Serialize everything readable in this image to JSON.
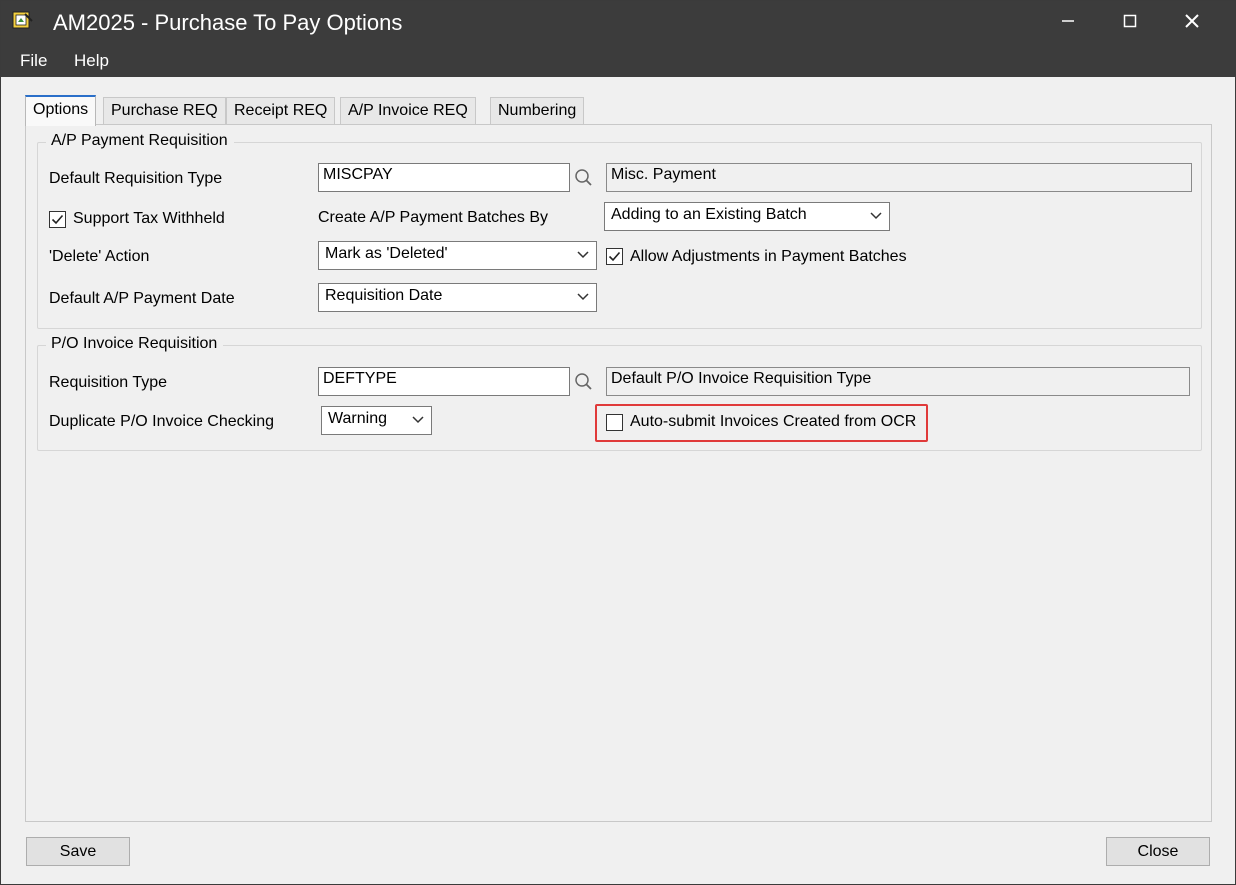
{
  "window": {
    "title": "AM2025 - Purchase To Pay Options",
    "icon": "app-icon",
    "controls": {
      "minimize": "minimize-icon",
      "maximize": "maximize-icon",
      "close": "close-icon"
    }
  },
  "menu": {
    "file": "File",
    "help": "Help"
  },
  "tabs": [
    {
      "label": "Options",
      "active": true
    },
    {
      "label": "Purchase REQ",
      "active": false
    },
    {
      "label": "Receipt REQ",
      "active": false
    },
    {
      "label": "A/P Invoice REQ",
      "active": false
    },
    {
      "label": "Numbering",
      "active": false
    }
  ],
  "ap_payment": {
    "legend": "A/P Payment Requisition",
    "default_req_type_label": "Default Requisition Type",
    "default_req_type_value": "MISCPAY",
    "default_req_type_desc": "Misc. Payment",
    "support_tax_withheld_label": "Support Tax Withheld",
    "support_tax_withheld_checked": true,
    "create_batches_label": "Create A/P Payment Batches By",
    "create_batches_value": "Adding to an Existing Batch",
    "delete_action_label": "'Delete' Action",
    "delete_action_value": "Mark as 'Deleted'",
    "allow_adjustments_label": "Allow Adjustments in Payment Batches",
    "allow_adjustments_checked": true,
    "default_payment_date_label": "Default A/P Payment Date",
    "default_payment_date_value": "Requisition Date"
  },
  "po_invoice": {
    "legend": "P/O Invoice Requisition",
    "req_type_label": "Requisition Type",
    "req_type_value": "DEFTYPE",
    "req_type_desc": "Default P/O Invoice Requisition Type",
    "duplicate_check_label": "Duplicate P/O Invoice Checking",
    "duplicate_check_value": "Warning",
    "auto_submit_label": "Auto-submit Invoices Created from OCR",
    "auto_submit_checked": false,
    "highlight_color": "#e03a3a"
  },
  "buttons": {
    "save": "Save",
    "close": "Close"
  },
  "colors": {
    "titlebar": "#3c3c3c",
    "active_tab_accent": "#2a6fc9"
  }
}
